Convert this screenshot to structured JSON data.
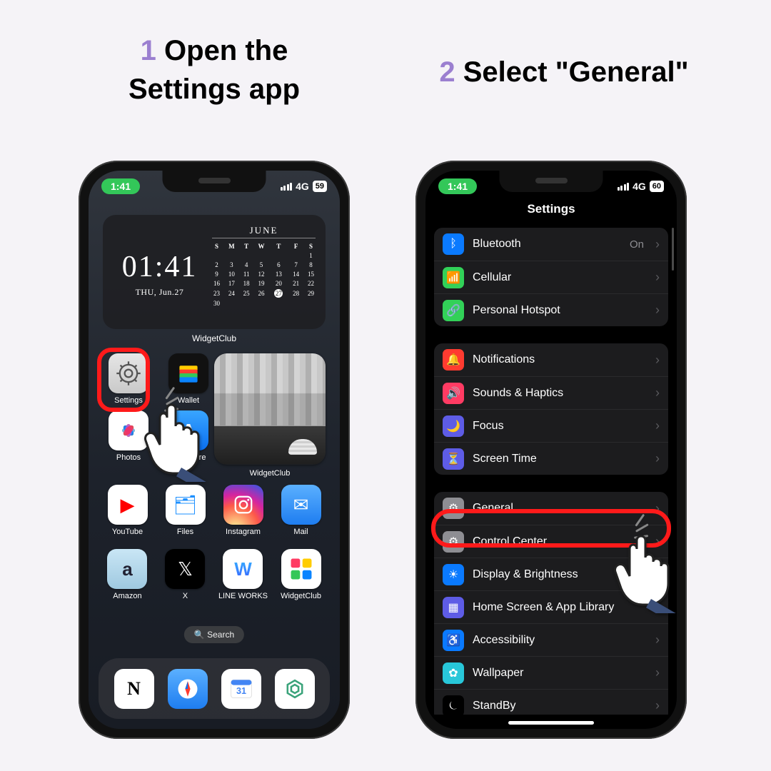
{
  "steps": {
    "one_num": "1",
    "one_text": "Open the Settings app",
    "two_num": "2",
    "two_text": "Select \"General\""
  },
  "status": {
    "time": "1:41",
    "net": "4G",
    "batt1": "59",
    "batt2": "60"
  },
  "home": {
    "widget_clock_time": "01:41",
    "widget_clock_day": "THU, Jun.27",
    "widget_cal_month": "JUNE",
    "widget_label": "WidgetClub",
    "photo_label": "WidgetClub",
    "search": "🔍 Search",
    "apps_leftcol": [
      {
        "id": "settings",
        "label": "Settings"
      },
      {
        "id": "wallet",
        "label": "Wallet"
      },
      {
        "id": "photos",
        "label": "Photos"
      },
      {
        "id": "appstore",
        "label": "App Store"
      }
    ],
    "apps_r3": [
      {
        "id": "youtube",
        "label": "YouTube"
      },
      {
        "id": "files",
        "label": "Files"
      },
      {
        "id": "instagram",
        "label": "Instagram"
      },
      {
        "id": "mail",
        "label": "Mail"
      }
    ],
    "apps_r4": [
      {
        "id": "amazon",
        "label": "Amazon"
      },
      {
        "id": "x",
        "label": "X"
      },
      {
        "id": "lineworks",
        "label": "LINE WORKS"
      },
      {
        "id": "widgetclub",
        "label": "WidgetClub"
      }
    ]
  },
  "settings": {
    "title": "Settings",
    "group1": [
      {
        "name": "Bluetooth",
        "val": "On",
        "color": "#0a7aff",
        "glyph": "ᛒ"
      },
      {
        "name": "Cellular",
        "color": "#32d158",
        "glyph": "📶"
      },
      {
        "name": "Personal Hotspot",
        "color": "#32d158",
        "glyph": "🔗"
      }
    ],
    "group2": [
      {
        "name": "Notifications",
        "color": "#ff3b30",
        "glyph": "🔔"
      },
      {
        "name": "Sounds & Haptics",
        "color": "#ff3b63",
        "glyph": "🔊"
      },
      {
        "name": "Focus",
        "color": "#5e5ce6",
        "glyph": "🌙"
      },
      {
        "name": "Screen Time",
        "color": "#5e5ce6",
        "glyph": "⏳"
      }
    ],
    "group3": [
      {
        "name": "General",
        "color": "#8e8e93",
        "glyph": "⚙"
      },
      {
        "name": "Control Center",
        "color": "#8e8e93",
        "glyph": "⚙"
      },
      {
        "name": "Display & Brightness",
        "color": "#0a7aff",
        "glyph": "☀"
      },
      {
        "name": "Home Screen & App Library",
        "color": "#5e5ce6",
        "glyph": "▦"
      },
      {
        "name": "Accessibility",
        "color": "#0a7aff",
        "glyph": "♿"
      },
      {
        "name": "Wallpaper",
        "color": "#28c7d9",
        "glyph": "✿"
      },
      {
        "name": "StandBy",
        "color": "#000000",
        "glyph": "⏾"
      }
    ]
  }
}
